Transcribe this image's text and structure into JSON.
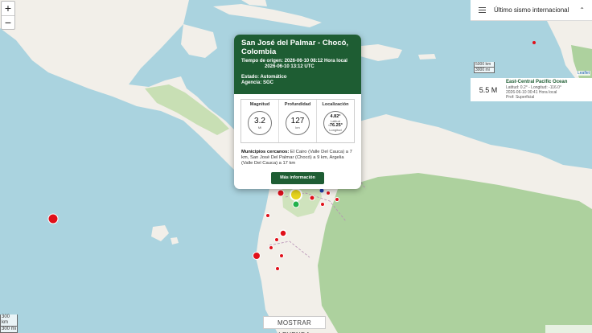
{
  "map": {
    "zoom_in": "+",
    "zoom_out": "−",
    "scale_km": "300 km",
    "scale_mi": "300 mi",
    "legend_button": "MOSTRAR LEYENDA",
    "colors": {
      "water": "#aad3df",
      "land": "#f2efe9",
      "forest": "#add19e",
      "marker_red": "#e0101a",
      "marker_green": "#22b14c",
      "marker_yellow": "#e8d51e"
    }
  },
  "popup": {
    "title": "San José del Palmar - Chocó, Colombia",
    "origin_label": "Tiempo de origen:",
    "origin_local": "2026-06-10 08:12 Hora local",
    "origin_utc": "2026-06-10 13:12 UTC",
    "status": "Estado: Automático",
    "agency": "Agencia: SGC",
    "magnitude_label": "Magnitud",
    "magnitude_value": "3.2",
    "magnitude_unit": "Ml",
    "depth_label": "Profundidad",
    "depth_value": "127",
    "depth_unit": "km",
    "location_label": "Localización",
    "lat_value": "4.82°",
    "lat_label": "Latitud",
    "lon_value": "-76.25°",
    "lon_label": "Longitud",
    "municipios_label": "Municipios cercanos:",
    "municipios_text": "El Cairo (Valle Del Cauca) a 7 km, San José Del Palmar (Chocó) a 9 km, Argelia (Valle Del Cauca) a 17 km",
    "more_button": "Más información"
  },
  "panel": {
    "title": "Último sismo internacional",
    "scale_km": "5000 km",
    "scale_mi": "3000 mi",
    "attribution": "Leaflet",
    "magnitude": "5.5 M",
    "region": "East-Central Pacific Ocean",
    "coords": "Latitud: 0.2° - Longitud: -116.0°",
    "time": "2026-06-10 00:41 Hora local",
    "depth": "Prof: Superficial"
  }
}
